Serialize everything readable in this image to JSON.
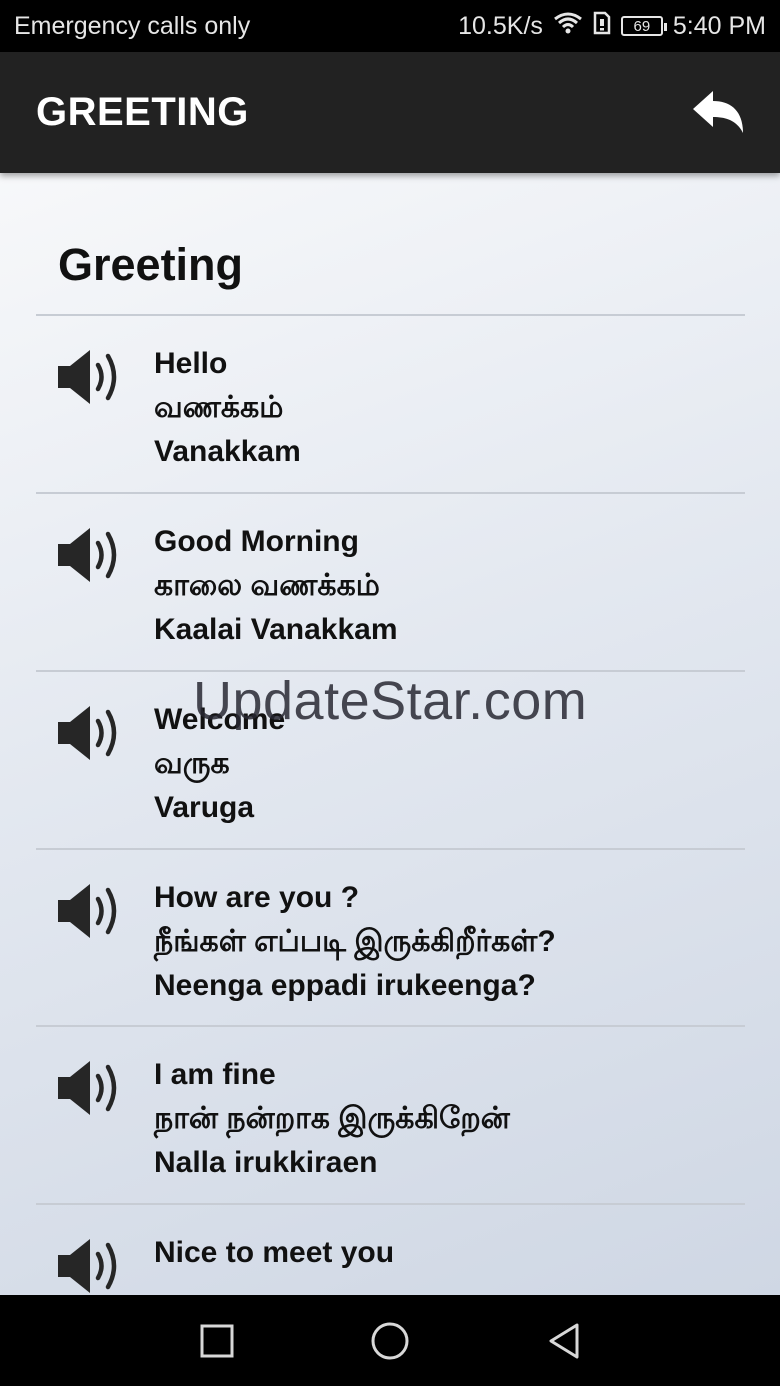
{
  "status_bar": {
    "carrier_text": "Emergency calls only",
    "net_speed": "10.5K/s",
    "battery_level": "69",
    "time": "5:40 PM",
    "icons": [
      "wifi-icon",
      "sim-icon",
      "battery-icon"
    ]
  },
  "app_bar": {
    "title": "GREETING",
    "back_icon": "reply-back-icon"
  },
  "section": {
    "title": "Greeting"
  },
  "phrases": [
    {
      "english": "Hello",
      "tamil": "வணக்கம்",
      "transliteration": "Vanakkam"
    },
    {
      "english": "Good Morning",
      "tamil": "காலை வணக்கம்",
      "transliteration": "Kaalai Vanakkam"
    },
    {
      "english": "Welcome",
      "tamil": "வருக",
      "transliteration": "Varuga"
    },
    {
      "english": "How are you ?",
      "tamil": "நீங்கள் எப்படி இருக்கிறீர்கள்?",
      "transliteration": "Neenga eppadi irukeenga?"
    },
    {
      "english": "I am fine",
      "tamil": "நான் நன்றாக இருக்கிறேன்",
      "transliteration": "Nalla irukkiraen"
    },
    {
      "english": "Nice to meet you",
      "tamil": "",
      "transliteration": ""
    }
  ],
  "watermark": "UpdateStar.com",
  "nav_bar": {
    "icons": [
      "recents-square-icon",
      "home-circle-icon",
      "back-triangle-icon"
    ]
  }
}
